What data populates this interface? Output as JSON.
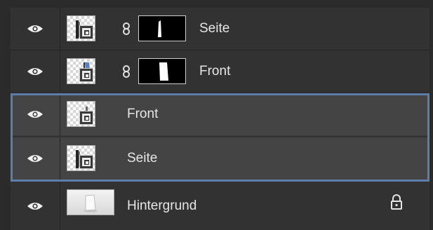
{
  "layers": [
    {
      "name": "Seite",
      "visible": true,
      "has_mask": true,
      "linked": true,
      "selected": false,
      "smart_object": true
    },
    {
      "name": "Front",
      "visible": true,
      "has_mask": true,
      "linked": true,
      "selected": false,
      "smart_object": true
    },
    {
      "name": "Front",
      "visible": true,
      "has_mask": false,
      "linked": false,
      "selected": true,
      "smart_object": true
    },
    {
      "name": "Seite",
      "visible": true,
      "has_mask": false,
      "linked": false,
      "selected": true,
      "smart_object": true
    },
    {
      "name": "Hintergrund",
      "visible": true,
      "has_mask": false,
      "linked": false,
      "selected": false,
      "smart_object": false,
      "locked": true
    }
  ],
  "icons": {
    "visibility": "eye-icon",
    "link": "chain-link-icon",
    "lock": "lock-icon",
    "smart_object": "smart-object-badge-icon"
  },
  "colors": {
    "panel_bg": "#323232",
    "selected_bg": "#444444",
    "selection_border": "#5c7ea8",
    "text": "#e6e6e6"
  }
}
